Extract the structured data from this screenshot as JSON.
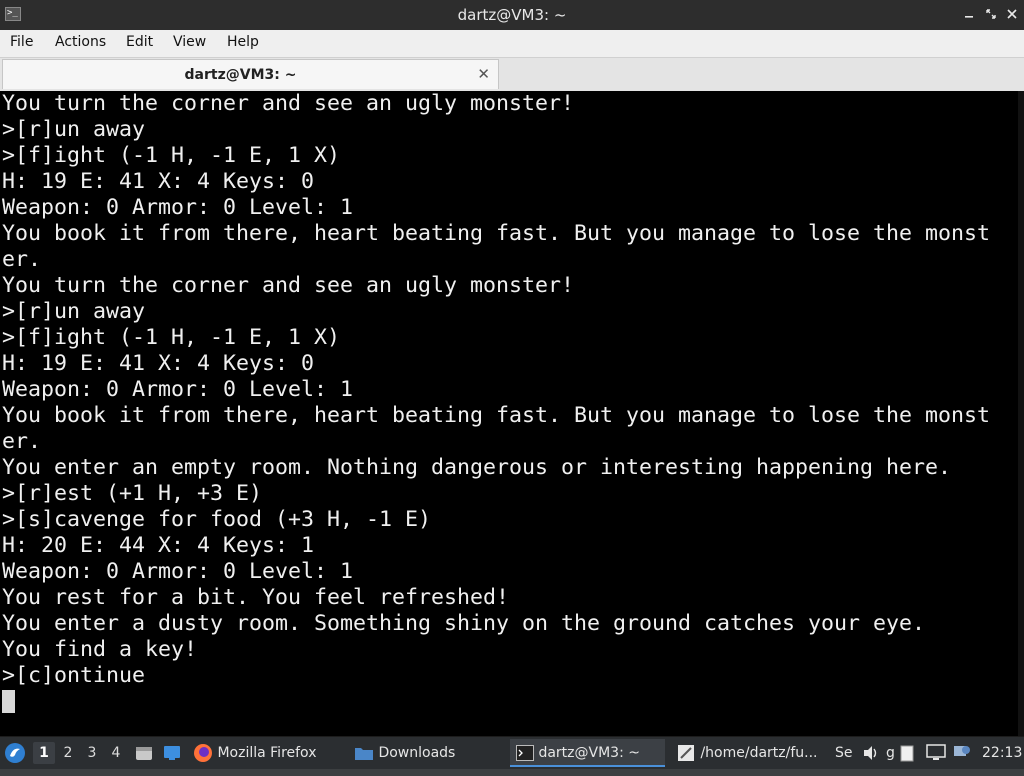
{
  "window": {
    "title": "dartz@VM3: ~",
    "controls": [
      "minimize",
      "maximize",
      "close"
    ]
  },
  "menu": [
    "File",
    "Actions",
    "Edit",
    "View",
    "Help"
  ],
  "tab": {
    "label": "dartz@VM3: ~"
  },
  "terminal": {
    "lines": [
      "You turn the corner and see an ugly monster!",
      ">[r]un away",
      ">[f]ight (-1 H, -1 E, 1 X)",
      "H: 19 E: 41 X: 4 Keys: 0",
      "Weapon: 0 Armor: 0 Level: 1",
      "You book it from there, heart beating fast. But you manage to lose the monst",
      "er.",
      "You turn the corner and see an ugly monster!",
      ">[r]un away",
      ">[f]ight (-1 H, -1 E, 1 X)",
      "H: 19 E: 41 X: 4 Keys: 0",
      "Weapon: 0 Armor: 0 Level: 1",
      "You book it from there, heart beating fast. But you manage to lose the monst",
      "er.",
      "You enter an empty room. Nothing dangerous or interesting happening here.",
      ">[r]est (+1 H, +3 E)",
      ">[s]cavenge for food (+3 H, -1 E)",
      "H: 20 E: 44 X: 4 Keys: 1",
      "Weapon: 0 Armor: 0 Level: 1",
      "You rest for a bit. You feel refreshed!",
      "You enter a dusty room. Something shiny on the ground catches your eye.",
      "You find a key!",
      ">[c]ontinue"
    ]
  },
  "taskbar": {
    "workspaces": [
      "1",
      "2",
      "3",
      "4"
    ],
    "active_workspace": "1",
    "tasks": [
      {
        "label": "Mozilla Firefox",
        "icon": "firefox-icon"
      },
      {
        "label": "Downloads",
        "icon": "folder-icon"
      },
      {
        "label": "dartz@VM3: ~",
        "icon": "terminal-icon",
        "active": true
      },
      {
        "label": "/home/dartz/fu...",
        "icon": "text-editor-icon"
      }
    ],
    "tray_clipped": [
      "Se",
      "g"
    ],
    "clock": "22:13"
  },
  "colors": {
    "terminal_bg": "#000000",
    "terminal_fg": "#f0f0f0",
    "titlebar_bg": "#2d2d2d",
    "taskbar_bg": "#2b2e31",
    "accent": "#4a90d9"
  }
}
